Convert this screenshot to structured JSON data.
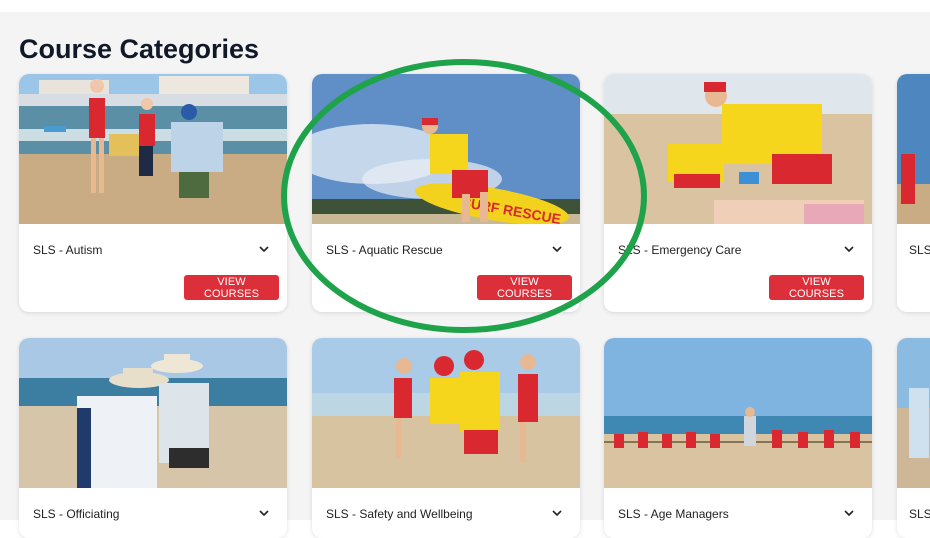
{
  "page": {
    "title": "Course Categories"
  },
  "cards": [
    {
      "label": "SLS - Autism",
      "button": "VIEW COURSES",
      "image": "children-beach-autism-photo"
    },
    {
      "label": "SLS - Aquatic Rescue",
      "button": "VIEW COURSES",
      "image": "lifesaver-rescue-board-photo"
    },
    {
      "label": "SLS - Emergency Care",
      "button": "VIEW COURSES",
      "image": "cpr-on-beach-photo"
    },
    {
      "label": "SLS",
      "image": "beach-partial-photo"
    },
    {
      "label": "SLS - Officiating",
      "image": "officials-clipboard-photo"
    },
    {
      "label": "SLS - Safety and Wellbeing",
      "image": "lifesavers-kids-photo"
    },
    {
      "label": "SLS - Age Managers",
      "image": "tug-of-war-beach-photo"
    },
    {
      "label": "SLS",
      "image": "beach-partial-photo-2"
    }
  ],
  "highlight": {
    "color": "#1fa34a",
    "target": "SLS - Aquatic Rescue"
  },
  "colors": {
    "button": "#dc2f3a",
    "background": "#f4f4f5"
  }
}
